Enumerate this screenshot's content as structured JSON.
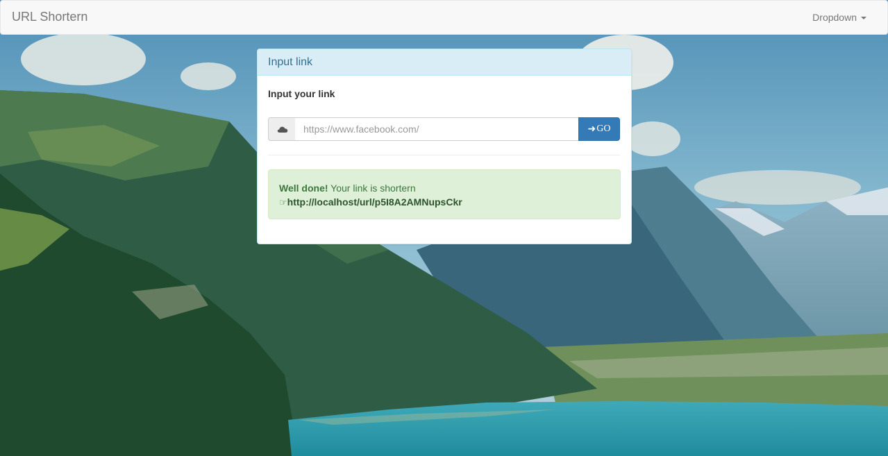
{
  "navbar": {
    "brand": "URL Shortern",
    "dropdown_label": "Dropdown"
  },
  "panel": {
    "title": "Input link",
    "input_label": "Input your link",
    "input_value": "",
    "input_placeholder": "https://www.facebook.com/",
    "go_label": "GO",
    "go_icon": "arrow-right-icon",
    "addon_icon": "cloud-icon"
  },
  "alert": {
    "strong": "Well done!",
    "message": " Your link is shortern",
    "link_icon": "hand-right-icon",
    "short_url": "http://localhost/url/p5I8A2AMNupsCkr"
  },
  "colors": {
    "navbar_bg": "#f8f8f8",
    "panel_heading_bg": "#d9edf7",
    "panel_title": "#31708f",
    "button_primary": "#337ab7",
    "alert_bg": "#dff0d8",
    "alert_text": "#3c763d"
  }
}
